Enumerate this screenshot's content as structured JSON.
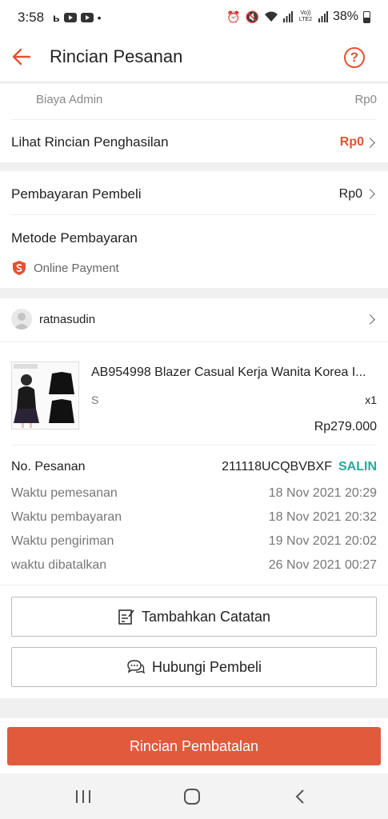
{
  "status": {
    "time": "3:58",
    "battery": "38%",
    "volte": "Vo)) LTE2"
  },
  "header": {
    "title": "Rincian Pesanan"
  },
  "income": {
    "admin_label": "Biaya Admin",
    "admin_value": "Rp0",
    "detail_label": "Lihat Rincian Penghasilan",
    "detail_value": "Rp0"
  },
  "payment": {
    "buyer_label": "Pembayaran Pembeli",
    "buyer_value": "Rp0",
    "method_label": "Metode Pembayaran",
    "method_value": "Online Payment"
  },
  "buyer": {
    "username": "ratnasudin"
  },
  "product": {
    "name": "AB954998 Blazer Casual Kerja Wanita Korea I...",
    "variant": "S",
    "qty": "x1",
    "price": "Rp279.000"
  },
  "order": {
    "number_label": "No. Pesanan",
    "number_value": "211118UCQBVBXF",
    "copy_label": "SALIN",
    "rows": [
      {
        "label": "Waktu pemesanan",
        "value": "18 Nov 2021 20:29"
      },
      {
        "label": "Waktu pembayaran",
        "value": "18 Nov 2021 20:32"
      },
      {
        "label": "Waktu pengiriman",
        "value": "19 Nov 2021 20:02"
      },
      {
        "label": "waktu dibatalkan",
        "value": "26 Nov 2021 00:27"
      }
    ]
  },
  "actions": {
    "add_note": "Tambahkan Catatan",
    "contact_buyer": "Hubungi Pembeli",
    "cancel_detail": "Rincian Pembatalan"
  },
  "colors": {
    "accent": "#e05433",
    "copy": "#26aa99"
  }
}
